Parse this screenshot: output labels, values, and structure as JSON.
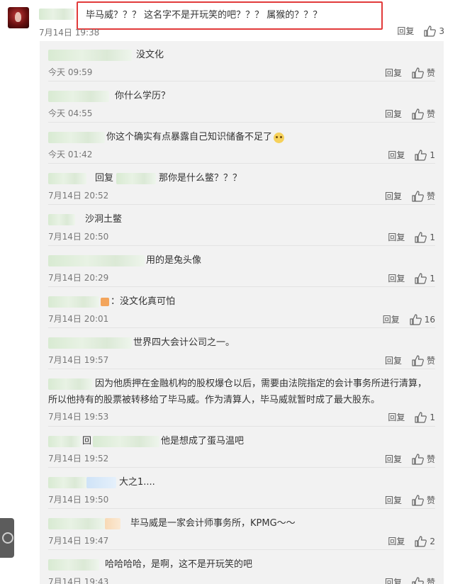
{
  "top_comment": {
    "text": "毕马威？？？ 这名字不是开玩笑的吧？？？ 属猴的？？？",
    "time": "7月14日 19:38",
    "reply_label": "回复",
    "likes": "3"
  },
  "replies": [
    {
      "text": "没文化",
      "time": "今天 09:59",
      "reply_label": "回复",
      "likes": "赞"
    },
    {
      "text": "你什么学历？",
      "time": "今天 04:55",
      "reply_label": "回复",
      "likes": "赞"
    },
    {
      "text": "你这个确实有点暴露自己知识储备不足了",
      "time": "今天 01:42",
      "reply_label": "回复",
      "likes": "1"
    },
    {
      "prefix": "回复",
      "text": "那你是什么鳖？？？",
      "time": "7月14日 20:52",
      "reply_label": "回复",
      "likes": "赞"
    },
    {
      "text": "沙洞土鳖",
      "time": "7月14日 20:50",
      "reply_label": "回复",
      "likes": "1"
    },
    {
      "text": "用的是兔头像",
      "time": "7月14日 20:29",
      "reply_label": "回复",
      "likes": "1"
    },
    {
      "text": "：没文化真可怕",
      "time": "7月14日 20:01",
      "reply_label": "回复",
      "likes": "16"
    },
    {
      "text": "世界四大会计公司之一。",
      "time": "7月14日 19:57",
      "reply_label": "回复",
      "likes": "赞"
    },
    {
      "text": "因为他质押在金融机构的股权爆仓以后，需要由法院指定的会计事务所进行清算，",
      "text2": "所以他持有的股票被转移给了毕马威。作为清算人，毕马威就暂时成了最大股东。",
      "time": "7月14日 19:53",
      "reply_label": "回复",
      "likes": "1"
    },
    {
      "prefix": "回",
      "text": "他是想成了蛋马温吧",
      "time": "7月14日 19:52",
      "reply_label": "回复",
      "likes": "赞"
    },
    {
      "text": "大之1....",
      "time": "7月14日 19:50",
      "reply_label": "回复",
      "likes": "赞"
    },
    {
      "text": "毕马威是一家会计师事务所，KPMG～～",
      "time": "7月14日 19:47",
      "reply_label": "回复",
      "likes": "2"
    },
    {
      "text": "哈哈哈哈，是啊，这不是开玩笑的吧",
      "time": "7月14日 19:43",
      "reply_label": "回复",
      "likes": "赞"
    }
  ],
  "colors": {
    "highlight": "#e23a3a",
    "reply_bg": "#f2f2f2",
    "time": "#777777"
  },
  "icons": {
    "like": "thumbs-up-icon",
    "side": "floating-tool-icon"
  }
}
